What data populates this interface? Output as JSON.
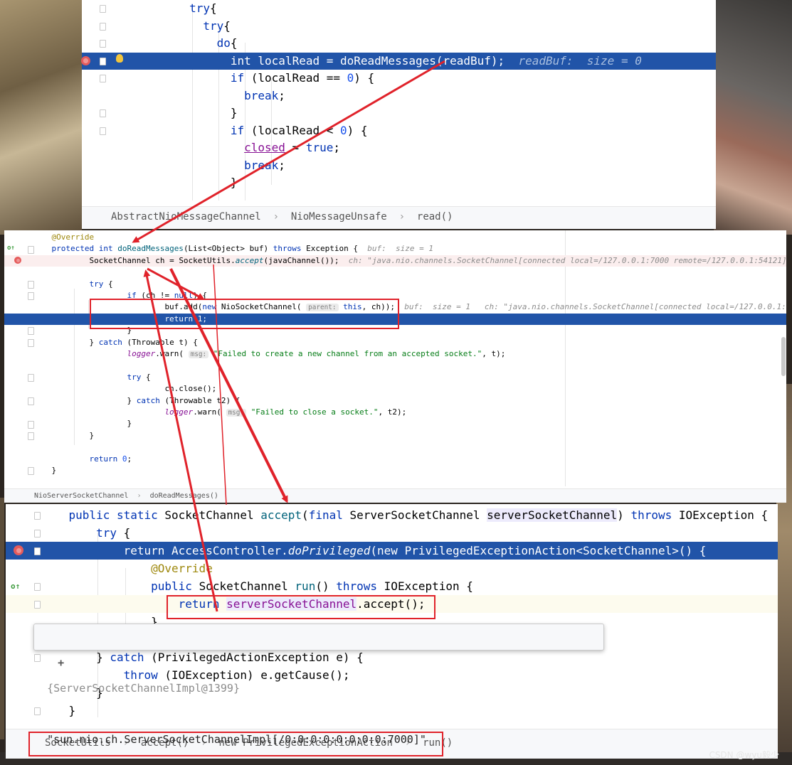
{
  "panel1": {
    "lines": [
      {
        "indent": "        ",
        "parts": [
          [
            "kw",
            "try"
          ],
          [
            "",
            "{"
          ]
        ]
      },
      {
        "indent": "          ",
        "parts": [
          [
            "kw",
            "try"
          ],
          [
            "",
            "{"
          ]
        ]
      },
      {
        "indent": "            ",
        "parts": [
          [
            "kw",
            "do"
          ],
          [
            "",
            "{"
          ]
        ]
      },
      {
        "indent": "              ",
        "parts": [
          [
            "kw",
            "int"
          ],
          [
            "",
            " localRead = "
          ],
          [
            "fn",
            "doReadMessages"
          ],
          [
            "",
            "(readBuf);  "
          ],
          [
            "hint",
            "readBuf:  size = 0"
          ]
        ]
      },
      {
        "indent": "              ",
        "parts": [
          [
            "kw",
            "if"
          ],
          [
            "",
            " (localRead == "
          ],
          [
            "num",
            "0"
          ],
          [
            "",
            ") {"
          ]
        ]
      },
      {
        "indent": "                ",
        "parts": [
          [
            "kw",
            "break"
          ],
          [
            "",
            ";"
          ]
        ]
      },
      {
        "indent": "              ",
        "parts": [
          [
            "",
            "}"
          ]
        ]
      },
      {
        "indent": "              ",
        "parts": [
          [
            "kw",
            "if"
          ],
          [
            "",
            " (localRead < "
          ],
          [
            "num",
            "0"
          ],
          [
            "",
            ") {"
          ]
        ]
      },
      {
        "indent": "                ",
        "parts": [
          [
            "field",
            "closed"
          ],
          [
            "",
            " = "
          ],
          [
            "kw",
            "true"
          ],
          [
            "",
            ";"
          ]
        ]
      },
      {
        "indent": "                ",
        "parts": [
          [
            "kw",
            "break"
          ],
          [
            "",
            ";"
          ]
        ]
      },
      {
        "indent": "              ",
        "parts": [
          [
            "",
            "}"
          ]
        ]
      }
    ],
    "breadcrumb": [
      "AbstractNioMessageChannel",
      "NioMessageUnsafe",
      "read()"
    ]
  },
  "panel2": {
    "lines": [
      {
        "indent": "  ",
        "parts": [
          [
            "ann",
            "@Override"
          ]
        ]
      },
      {
        "indent": "  ",
        "parts": [
          [
            "kw",
            "protected int "
          ],
          [
            "fn",
            "doReadMessages"
          ],
          [
            "",
            "(List<Object> buf) "
          ],
          [
            "kw",
            "throws"
          ],
          [
            "",
            " Exception {  "
          ],
          [
            "hint",
            "buf:  size = 1"
          ]
        ]
      },
      {
        "indent": "      ",
        "parts": [
          [
            "",
            "SocketChannel ch = SocketUtils."
          ],
          [
            "fnit",
            "accept"
          ],
          [
            "",
            "(javaChannel());  "
          ],
          [
            "hint",
            "ch: \"java.nio.channels.SocketChannel[connected local=/127.0.0.1:7000 remote=/127.0.0.1:54121]\""
          ]
        ]
      },
      {
        "indent": "",
        "parts": []
      },
      {
        "indent": "      ",
        "parts": [
          [
            "kw",
            "try"
          ],
          [
            "",
            " {"
          ]
        ]
      },
      {
        "indent": "          ",
        "parts": [
          [
            "kw",
            "if"
          ],
          [
            "",
            " (ch != "
          ],
          [
            "kw",
            "null"
          ],
          [
            "",
            ") {"
          ]
        ]
      },
      {
        "indent": "              ",
        "parts": [
          [
            "",
            "buf.add("
          ],
          [
            "kw",
            "new"
          ],
          [
            "",
            " NioSocketChannel( "
          ],
          [
            "lbl",
            "parent:"
          ],
          [
            " ",
            " "
          ],
          [
            "kw",
            "this"
          ],
          [
            "",
            ", ch));  "
          ],
          [
            "hint",
            "buf:  size = 1   ch: \"java.nio.channels.SocketChannel[connected local=/127.0.0.1:7000 remote=/127.0.0.1:5"
          ]
        ]
      },
      {
        "indent": "              ",
        "parts": [
          [
            "kw",
            "return "
          ],
          [
            "num",
            "1"
          ],
          [
            "",
            ";"
          ]
        ]
      },
      {
        "indent": "          ",
        "parts": [
          [
            "",
            "}"
          ]
        ]
      },
      {
        "indent": "      ",
        "parts": [
          [
            "",
            "} "
          ],
          [
            "kw",
            "catch"
          ],
          [
            "",
            " (Throwable t) {"
          ]
        ]
      },
      {
        "indent": "          ",
        "parts": [
          [
            "log",
            "logger"
          ],
          [
            "",
            ".warn( "
          ],
          [
            "lbl",
            "msg:"
          ],
          [
            "",
            " "
          ],
          [
            "str",
            "\"Failed to create a new channel from an accepted socket.\""
          ],
          [
            "",
            ", t);"
          ]
        ]
      },
      {
        "indent": "",
        "parts": []
      },
      {
        "indent": "          ",
        "parts": [
          [
            "kw",
            "try"
          ],
          [
            "",
            " {"
          ]
        ]
      },
      {
        "indent": "              ",
        "parts": [
          [
            "",
            "ch.close();"
          ]
        ]
      },
      {
        "indent": "          ",
        "parts": [
          [
            "",
            "} "
          ],
          [
            "kw",
            "catch"
          ],
          [
            "",
            " (Throwable t2) {"
          ]
        ]
      },
      {
        "indent": "              ",
        "parts": [
          [
            "log",
            "logger"
          ],
          [
            "",
            ".warn( "
          ],
          [
            "lbl",
            "msg:"
          ],
          [
            "",
            " "
          ],
          [
            "str",
            "\"Failed to close a socket.\""
          ],
          [
            "",
            ", t2);"
          ]
        ]
      },
      {
        "indent": "          ",
        "parts": [
          [
            "",
            "}"
          ]
        ]
      },
      {
        "indent": "      ",
        "parts": [
          [
            "",
            "}"
          ]
        ]
      },
      {
        "indent": "",
        "parts": []
      },
      {
        "indent": "      ",
        "parts": [
          [
            "kw",
            "return "
          ],
          [
            "num",
            "0"
          ],
          [
            "",
            ";"
          ]
        ]
      },
      {
        "indent": "  ",
        "parts": [
          [
            "",
            "}"
          ]
        ]
      }
    ],
    "breadcrumb": [
      "NioServerSocketChannel",
      "doReadMessages()"
    ]
  },
  "panel3": {
    "lines": [
      {
        "indent": "  ",
        "parts": [
          [
            "kw",
            "public static "
          ],
          [
            "",
            "SocketChannel "
          ],
          [
            "fn",
            "accept"
          ],
          [
            "",
            "("
          ],
          [
            "kw",
            "final "
          ],
          [
            "",
            "ServerSocketChannel "
          ],
          [
            "param",
            "serverSocketChannel"
          ],
          [
            "",
            ") "
          ],
          [
            "kw",
            "throws "
          ],
          [
            "",
            "IOException {  s"
          ]
        ]
      },
      {
        "indent": "    ",
        "parts": [
          [
            "kw",
            "try"
          ],
          [
            "",
            " {"
          ]
        ]
      },
      {
        "indent": "      ",
        "parts": [
          [
            "kw",
            "return "
          ],
          [
            "",
            "AccessController."
          ],
          [
            "fnit",
            "doPrivileged"
          ],
          [
            "",
            "("
          ],
          [
            "kw",
            "new "
          ],
          [
            "",
            "PrivilegedExceptionAction<SocketChannel>() {"
          ]
        ]
      },
      {
        "indent": "        ",
        "parts": [
          [
            "ann",
            "@Override"
          ]
        ]
      },
      {
        "indent": "        ",
        "parts": [
          [
            "kw",
            "public "
          ],
          [
            "",
            "SocketChannel "
          ],
          [
            "fn",
            "run"
          ],
          [
            "",
            "() "
          ],
          [
            "kw",
            "throws "
          ],
          [
            "",
            "IOException {"
          ]
        ]
      },
      {
        "indent": "          ",
        "parts": [
          [
            "kw",
            "return "
          ],
          [
            "fieldp",
            "serverSocketChannel"
          ],
          [
            "",
            ".accept();"
          ]
        ]
      },
      {
        "indent": "        ",
        "parts": [
          [
            "",
            "}"
          ]
        ]
      },
      {
        "indent": "",
        "parts": []
      },
      {
        "indent": "    ",
        "parts": [
          [
            "",
            "} "
          ],
          [
            "kw",
            "catch"
          ],
          [
            "",
            " (PrivilegedActionException e) {"
          ]
        ]
      },
      {
        "indent": "      ",
        "parts": [
          [
            "kw",
            "throw"
          ],
          [
            "",
            " (IOException) e.getCause();"
          ]
        ]
      },
      {
        "indent": "    ",
        "parts": [
          [
            "",
            "}"
          ]
        ]
      },
      {
        "indent": "  ",
        "parts": [
          [
            "",
            "}"
          ]
        ]
      }
    ],
    "breadcrumb": [
      "SocketUtils",
      "accept()",
      "new PrivilegedExceptionAction",
      "run()"
    ],
    "tooltip": {
      "plus": "+",
      "ref": "{ServerSocketChannelImpl@1399}",
      "value": "\"sun.nio.ch.ServerSocketChannelImpl[/0:0:0:0:0:0:0:0:7000]\""
    }
  },
  "watermark": "CSDN @wyu毅少",
  "colors": {
    "highlight": "#2154a8",
    "breakpoint": "#e55b5b",
    "annotation_red": "#e0222a",
    "keyword": "#0033b3"
  },
  "icons": [
    "breakpoint-icon",
    "lightbulb-icon",
    "override-icon",
    "fold-icon",
    "expand-icon"
  ]
}
